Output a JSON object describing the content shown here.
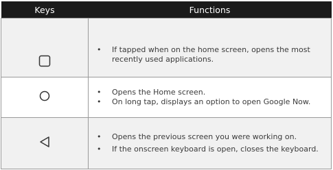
{
  "table": {
    "headers": {
      "keys": "Keys",
      "functions": "Functions"
    },
    "rows": [
      {
        "key_icon": "square-recent-apps-icon",
        "items": [
          "If tapped when on the home screen, opens the most recently used applications."
        ]
      },
      {
        "key_icon": "circle-home-icon",
        "items": [
          "Opens the Home screen.",
          "On long tap, displays an option to open Google Now."
        ]
      },
      {
        "key_icon": "triangle-back-icon",
        "items": [
          "Opens the previous screen you were working on.",
          "If the onscreen keyboard is open, closes the keyboard."
        ]
      }
    ]
  }
}
